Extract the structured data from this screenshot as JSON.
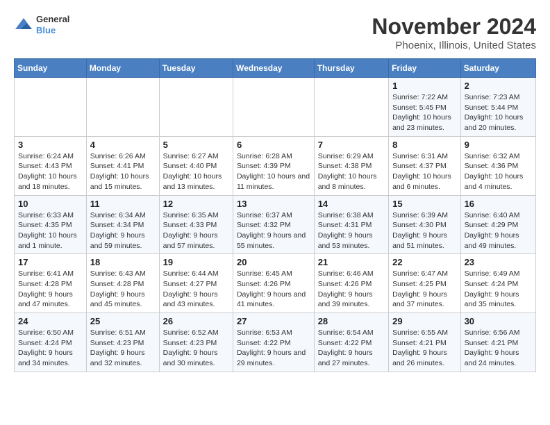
{
  "header": {
    "logo_line1": "General",
    "logo_line2": "Blue",
    "month": "November 2024",
    "location": "Phoenix, Illinois, United States"
  },
  "weekdays": [
    "Sunday",
    "Monday",
    "Tuesday",
    "Wednesday",
    "Thursday",
    "Friday",
    "Saturday"
  ],
  "weeks": [
    [
      {
        "day": "",
        "info": ""
      },
      {
        "day": "",
        "info": ""
      },
      {
        "day": "",
        "info": ""
      },
      {
        "day": "",
        "info": ""
      },
      {
        "day": "",
        "info": ""
      },
      {
        "day": "1",
        "info": "Sunrise: 7:22 AM\nSunset: 5:45 PM\nDaylight: 10 hours and 23 minutes."
      },
      {
        "day": "2",
        "info": "Sunrise: 7:23 AM\nSunset: 5:44 PM\nDaylight: 10 hours and 20 minutes."
      }
    ],
    [
      {
        "day": "3",
        "info": "Sunrise: 6:24 AM\nSunset: 4:43 PM\nDaylight: 10 hours and 18 minutes."
      },
      {
        "day": "4",
        "info": "Sunrise: 6:26 AM\nSunset: 4:41 PM\nDaylight: 10 hours and 15 minutes."
      },
      {
        "day": "5",
        "info": "Sunrise: 6:27 AM\nSunset: 4:40 PM\nDaylight: 10 hours and 13 minutes."
      },
      {
        "day": "6",
        "info": "Sunrise: 6:28 AM\nSunset: 4:39 PM\nDaylight: 10 hours and 11 minutes."
      },
      {
        "day": "7",
        "info": "Sunrise: 6:29 AM\nSunset: 4:38 PM\nDaylight: 10 hours and 8 minutes."
      },
      {
        "day": "8",
        "info": "Sunrise: 6:31 AM\nSunset: 4:37 PM\nDaylight: 10 hours and 6 minutes."
      },
      {
        "day": "9",
        "info": "Sunrise: 6:32 AM\nSunset: 4:36 PM\nDaylight: 10 hours and 4 minutes."
      }
    ],
    [
      {
        "day": "10",
        "info": "Sunrise: 6:33 AM\nSunset: 4:35 PM\nDaylight: 10 hours and 1 minute."
      },
      {
        "day": "11",
        "info": "Sunrise: 6:34 AM\nSunset: 4:34 PM\nDaylight: 9 hours and 59 minutes."
      },
      {
        "day": "12",
        "info": "Sunrise: 6:35 AM\nSunset: 4:33 PM\nDaylight: 9 hours and 57 minutes."
      },
      {
        "day": "13",
        "info": "Sunrise: 6:37 AM\nSunset: 4:32 PM\nDaylight: 9 hours and 55 minutes."
      },
      {
        "day": "14",
        "info": "Sunrise: 6:38 AM\nSunset: 4:31 PM\nDaylight: 9 hours and 53 minutes."
      },
      {
        "day": "15",
        "info": "Sunrise: 6:39 AM\nSunset: 4:30 PM\nDaylight: 9 hours and 51 minutes."
      },
      {
        "day": "16",
        "info": "Sunrise: 6:40 AM\nSunset: 4:29 PM\nDaylight: 9 hours and 49 minutes."
      }
    ],
    [
      {
        "day": "17",
        "info": "Sunrise: 6:41 AM\nSunset: 4:28 PM\nDaylight: 9 hours and 47 minutes."
      },
      {
        "day": "18",
        "info": "Sunrise: 6:43 AM\nSunset: 4:28 PM\nDaylight: 9 hours and 45 minutes."
      },
      {
        "day": "19",
        "info": "Sunrise: 6:44 AM\nSunset: 4:27 PM\nDaylight: 9 hours and 43 minutes."
      },
      {
        "day": "20",
        "info": "Sunrise: 6:45 AM\nSunset: 4:26 PM\nDaylight: 9 hours and 41 minutes."
      },
      {
        "day": "21",
        "info": "Sunrise: 6:46 AM\nSunset: 4:26 PM\nDaylight: 9 hours and 39 minutes."
      },
      {
        "day": "22",
        "info": "Sunrise: 6:47 AM\nSunset: 4:25 PM\nDaylight: 9 hours and 37 minutes."
      },
      {
        "day": "23",
        "info": "Sunrise: 6:49 AM\nSunset: 4:24 PM\nDaylight: 9 hours and 35 minutes."
      }
    ],
    [
      {
        "day": "24",
        "info": "Sunrise: 6:50 AM\nSunset: 4:24 PM\nDaylight: 9 hours and 34 minutes."
      },
      {
        "day": "25",
        "info": "Sunrise: 6:51 AM\nSunset: 4:23 PM\nDaylight: 9 hours and 32 minutes."
      },
      {
        "day": "26",
        "info": "Sunrise: 6:52 AM\nSunset: 4:23 PM\nDaylight: 9 hours and 30 minutes."
      },
      {
        "day": "27",
        "info": "Sunrise: 6:53 AM\nSunset: 4:22 PM\nDaylight: 9 hours and 29 minutes."
      },
      {
        "day": "28",
        "info": "Sunrise: 6:54 AM\nSunset: 4:22 PM\nDaylight: 9 hours and 27 minutes."
      },
      {
        "day": "29",
        "info": "Sunrise: 6:55 AM\nSunset: 4:21 PM\nDaylight: 9 hours and 26 minutes."
      },
      {
        "day": "30",
        "info": "Sunrise: 6:56 AM\nSunset: 4:21 PM\nDaylight: 9 hours and 24 minutes."
      }
    ]
  ]
}
